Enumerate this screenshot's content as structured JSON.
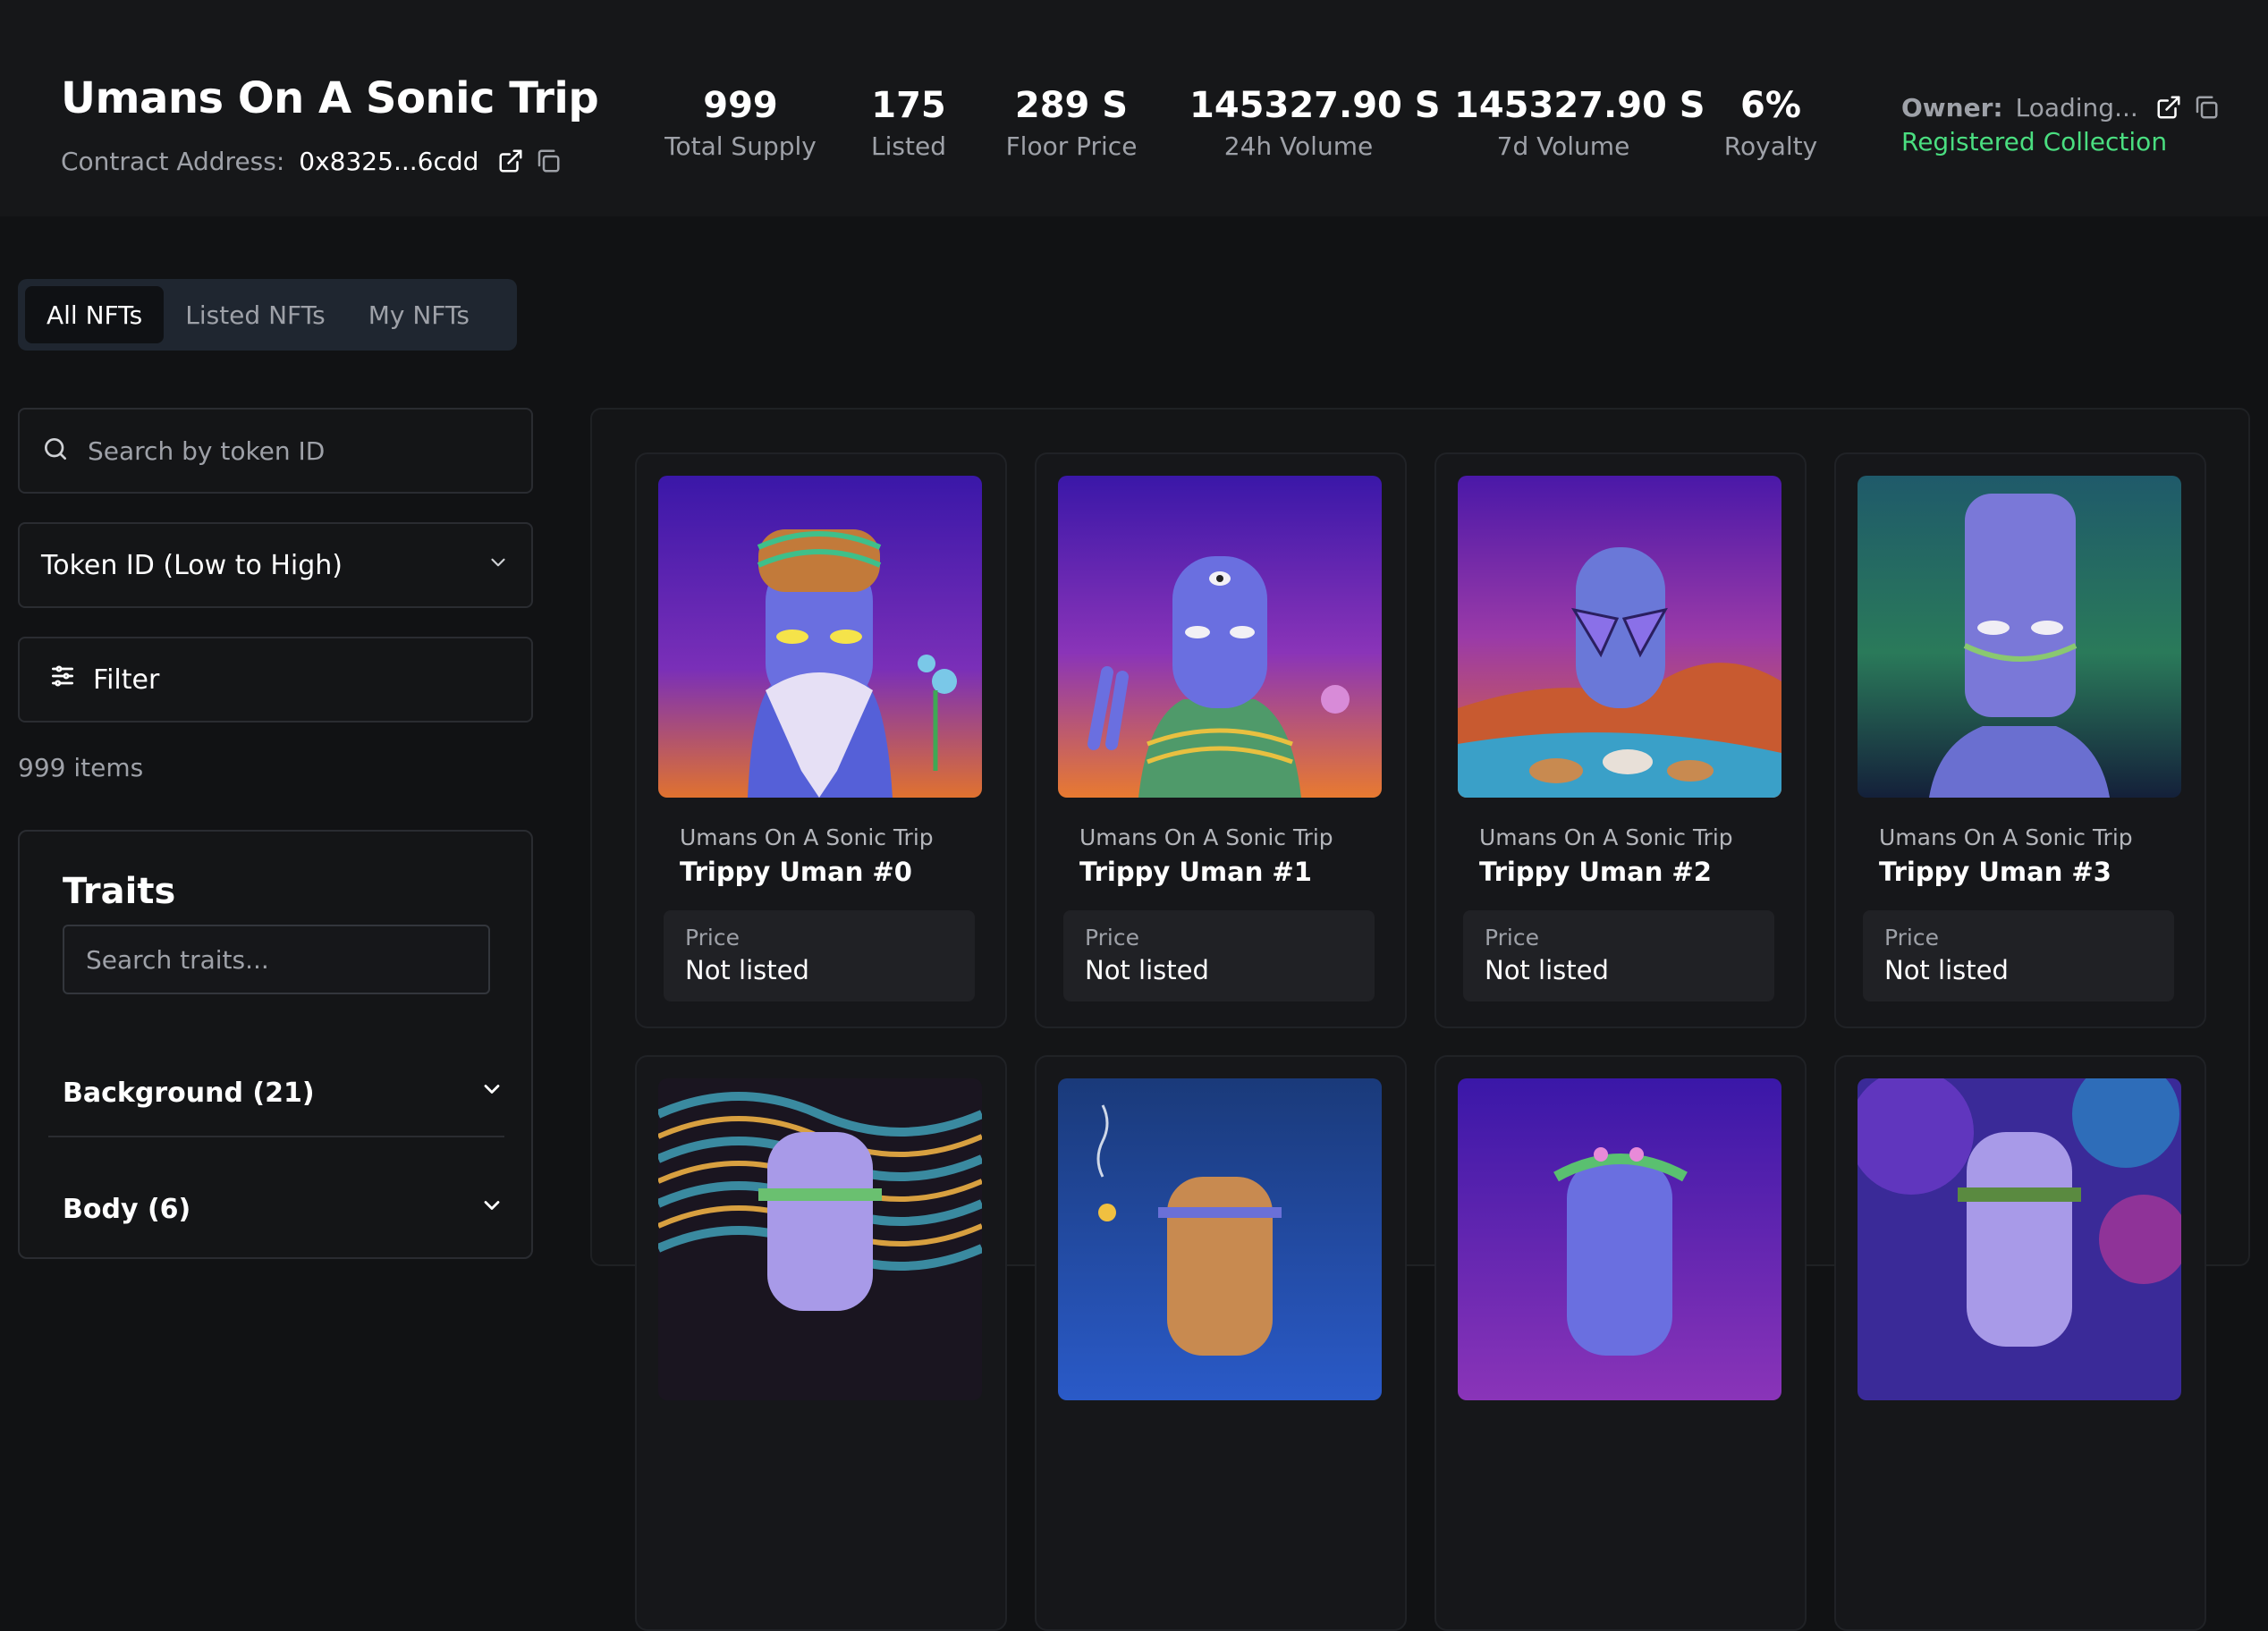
{
  "collection": {
    "title": "Umans On A Sonic Trip",
    "contract_label": "Contract Address:",
    "contract_address": "0x8325...6cdd"
  },
  "stats": [
    {
      "value": "999",
      "label": "Total Supply"
    },
    {
      "value": "175",
      "label": "Listed"
    },
    {
      "value": "289 S",
      "label": "Floor Price"
    },
    {
      "value": "145327.90 S",
      "label": "24h Volume"
    },
    {
      "value": "145327.90 S",
      "label": "7d Volume"
    },
    {
      "value": "6%",
      "label": "Royalty"
    }
  ],
  "owner": {
    "label": "Owner:",
    "value": "Loading...",
    "status": "Registered Collection"
  },
  "tabs": [
    "All NFTs",
    "Listed NFTs",
    "My NFTs"
  ],
  "sidebar": {
    "search_placeholder": "Search by token ID",
    "sort_value": "Token ID (Low to High)",
    "filter_label": "Filter",
    "item_count": "999 items",
    "traits_title": "Traits",
    "traits_search_placeholder": "Search traits...",
    "trait_groups": [
      "Background (21)",
      "Body (6)"
    ]
  },
  "cards": [
    {
      "collection": "Umans On A Sonic Trip",
      "name": "Trippy Uman #0",
      "price_label": "Price",
      "price": "Not listed"
    },
    {
      "collection": "Umans On A Sonic Trip",
      "name": "Trippy Uman #1",
      "price_label": "Price",
      "price": "Not listed"
    },
    {
      "collection": "Umans On A Sonic Trip",
      "name": "Trippy Uman #2",
      "price_label": "Price",
      "price": "Not listed"
    },
    {
      "collection": "Umans On A Sonic Trip",
      "name": "Trippy Uman #3",
      "price_label": "Price",
      "price": "Not listed"
    }
  ],
  "colors": {
    "background": "#111214",
    "accent_green": "#4ade80",
    "muted_text": "#9ea1a8"
  }
}
